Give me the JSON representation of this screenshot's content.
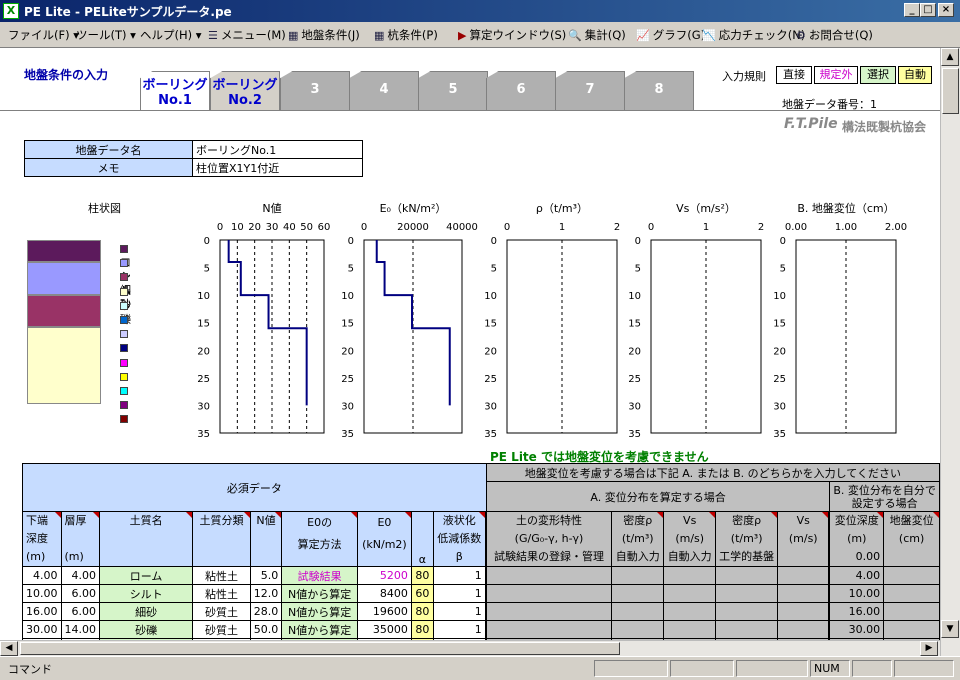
{
  "window": {
    "title": "PE Lite - PELiteサンプルデータ.pe",
    "app_icon": "excel-icon"
  },
  "menu": [
    {
      "label": "ファイル(F)",
      "arrow": "▾"
    },
    {
      "label": "ツール(T)",
      "arrow": "▾"
    },
    {
      "label": "ヘルプ(H)",
      "arrow": "▾"
    },
    {
      "label": "メニュー(M)",
      "icon": "list-icon"
    },
    {
      "label": "地盤条件(J)",
      "icon": "table-icon"
    },
    {
      "label": "杭条件(P)",
      "icon": "table-icon"
    },
    {
      "label": "算定ウインドウ(S)",
      "icon": "triangle-icon"
    },
    {
      "label": "集計(Q)",
      "icon": "magnify-icon"
    },
    {
      "label": "グラフ(G)",
      "icon": "graph-icon"
    },
    {
      "label": "応力チェック(N)",
      "icon": "graph-icon"
    },
    {
      "label": "お問合せ(Q)",
      "icon": "help-icon"
    }
  ],
  "header": {
    "section_title": "地盤条件の入力",
    "input_rule_label": "入力規則",
    "rules": [
      "直接",
      "規定外",
      "選択",
      "自動"
    ],
    "data_number": "地盤データ番号：1",
    "logo": "F.T.Pile",
    "logo_sub": "構法既製杭協会"
  },
  "tabs": [
    {
      "line1": "ボーリング",
      "line2": "No.1"
    },
    {
      "line1": "ボーリング",
      "line2": "No.2"
    },
    {
      "label": "3"
    },
    {
      "label": "4"
    },
    {
      "label": "5"
    },
    {
      "label": "6"
    },
    {
      "label": "7"
    },
    {
      "label": "8"
    }
  ],
  "info": {
    "name_label": "地盤データ名",
    "name_value": "ボーリングNo.1",
    "memo_label": "メモ",
    "memo_value": "柱位置X1Y1付近"
  },
  "column_legend": {
    "title": "柱状図",
    "items": [
      {
        "label": "ローム",
        "color": "#5c1a5c"
      },
      {
        "label": "シルト",
        "color": "#9999ff"
      },
      {
        "label": "細砂",
        "color": "#993366"
      },
      {
        "label": "砂礫",
        "color": "#ffffcc"
      },
      {
        "label": "",
        "color": "#ccffff"
      },
      {
        "label": "",
        "color": "#0066cc"
      },
      {
        "label": "",
        "color": "#ccccff"
      },
      {
        "label": "",
        "color": "#000080"
      },
      {
        "label": "",
        "color": "#ff00ff"
      },
      {
        "label": "",
        "color": "#ffff00"
      },
      {
        "label": "",
        "color": "#00ffff"
      },
      {
        "label": "",
        "color": "#800080"
      },
      {
        "label": "",
        "color": "#800000"
      }
    ],
    "layers": [
      {
        "top": 0,
        "bottom": 4,
        "color": "#5c1a5c"
      },
      {
        "top": 4,
        "bottom": 10,
        "color": "#9999ff"
      },
      {
        "top": 10,
        "bottom": 16,
        "color": "#993366"
      },
      {
        "top": 16,
        "bottom": 30,
        "color": "#ffffcc"
      }
    ]
  },
  "chart_data": [
    {
      "type": "line",
      "title": "N値",
      "xlim": [
        0,
        60
      ],
      "xticks": [
        0,
        10,
        20,
        30,
        40,
        50,
        60
      ],
      "ylim": [
        0,
        35
      ],
      "yticks": [
        0,
        5,
        10,
        15,
        20,
        25,
        30,
        35
      ],
      "steps": [
        {
          "from": 0,
          "to": 4,
          "x": 5
        },
        {
          "from": 4,
          "to": 10,
          "x": 12
        },
        {
          "from": 10,
          "to": 16,
          "x": 28
        },
        {
          "from": 16,
          "to": 30,
          "x": 50
        }
      ],
      "grid_x": [
        10,
        20,
        30,
        40,
        50
      ]
    },
    {
      "type": "line",
      "title": "E₀（kN/m²）",
      "xlim": [
        0,
        40000
      ],
      "xticks": [
        0,
        20000,
        40000
      ],
      "ylim": [
        0,
        35
      ],
      "yticks": [
        0,
        5,
        10,
        15,
        20,
        25,
        30,
        35
      ],
      "steps": [
        {
          "from": 0,
          "to": 4,
          "x": 5200
        },
        {
          "from": 4,
          "to": 10,
          "x": 8400
        },
        {
          "from": 10,
          "to": 16,
          "x": 19600
        },
        {
          "from": 16,
          "to": 30,
          "x": 35000
        }
      ],
      "grid_x": [
        20000
      ]
    },
    {
      "type": "line",
      "title": "ρ（t/m³）",
      "xlim": [
        0,
        2
      ],
      "xticks": [
        0,
        1,
        2
      ],
      "ylim": [
        0,
        35
      ],
      "yticks": [
        0,
        5,
        10,
        15,
        20,
        25,
        30,
        35
      ],
      "steps": [],
      "grid_x": [
        1
      ]
    },
    {
      "type": "line",
      "title": "Vs（m/s²）",
      "xlim": [
        0,
        2
      ],
      "xticks": [
        0,
        1,
        2
      ],
      "ylim": [
        0,
        35
      ],
      "yticks": [
        0,
        5,
        10,
        15,
        20,
        25,
        30,
        35
      ],
      "steps": [],
      "grid_x": [
        1
      ]
    },
    {
      "type": "line",
      "title": "B. 地盤変位（cm）",
      "xlim": [
        0,
        2
      ],
      "xticks": [
        "0.00",
        "1.00",
        "2.00"
      ],
      "ylim": [
        0,
        35
      ],
      "yticks": [
        0,
        5,
        10,
        15,
        20,
        25,
        30,
        35
      ],
      "steps": [],
      "grid_x": [
        1
      ]
    }
  ],
  "notice": "PE Lite では地盤変位を考慮できません",
  "table": {
    "required_header": "必須データ",
    "disp_header": "地盤変位を考慮する場合は下記 A. または B. のどちらかを入力してください",
    "a_header": "A. 変位分布を算定する場合",
    "b_header": "B. 変位分布を自分で設定する場合",
    "cols": {
      "bottom": [
        "下端",
        "深度",
        "(m)"
      ],
      "thick": [
        "層厚",
        "",
        "(m)"
      ],
      "soil_name": "土質名",
      "soil_class": "土質分類",
      "n": "N値",
      "e0method": [
        "E0の",
        "算定方法"
      ],
      "e0": [
        "E0",
        "(kN/m2)"
      ],
      "alpha": "α",
      "liq": [
        "液状化",
        "低減係数",
        "β"
      ],
      "deform": [
        "土の変形特性",
        "(G/G₀-γ, h-γ)",
        "試験結果の登録・管理"
      ],
      "density": [
        "密度ρ",
        "(t/m³)",
        "自動入力"
      ],
      "vs": [
        "Vs",
        "(m/s)",
        "自動入力"
      ],
      "density2": [
        "密度ρ",
        "(t/m³)"
      ],
      "vs2": [
        "Vs",
        "(m/s)"
      ],
      "eng_base": "工学的基盤",
      "disp_depth": [
        "変位深度",
        "(m)"
      ],
      "ground_disp": [
        "地盤変位",
        "(cm)"
      ]
    },
    "rows": [
      {
        "bottom": "4.00",
        "thick": "4.00",
        "name": "ローム",
        "cls": "粘性土",
        "n": "5.0",
        "method": "試験結果",
        "e0": "5200",
        "alpha": "80",
        "beta": "1",
        "depth": "4.00"
      },
      {
        "bottom": "10.00",
        "thick": "6.00",
        "name": "シルト",
        "cls": "粘性土",
        "n": "12.0",
        "method": "N値から算定",
        "e0": "8400",
        "alpha": "60",
        "beta": "1",
        "depth": "10.00"
      },
      {
        "bottom": "16.00",
        "thick": "6.00",
        "name": "細砂",
        "cls": "砂質土",
        "n": "28.0",
        "method": "N値から算定",
        "e0": "19600",
        "alpha": "80",
        "beta": "1",
        "depth": "16.00"
      },
      {
        "bottom": "30.00",
        "thick": "14.00",
        "name": "砂礫",
        "cls": "砂質土",
        "n": "50.0",
        "method": "N値から算定",
        "e0": "35000",
        "alpha": "80",
        "beta": "1",
        "depth": "30.00"
      }
    ],
    "first_depth": "0.00"
  },
  "status": {
    "command": "コマンド",
    "num": "NUM"
  }
}
